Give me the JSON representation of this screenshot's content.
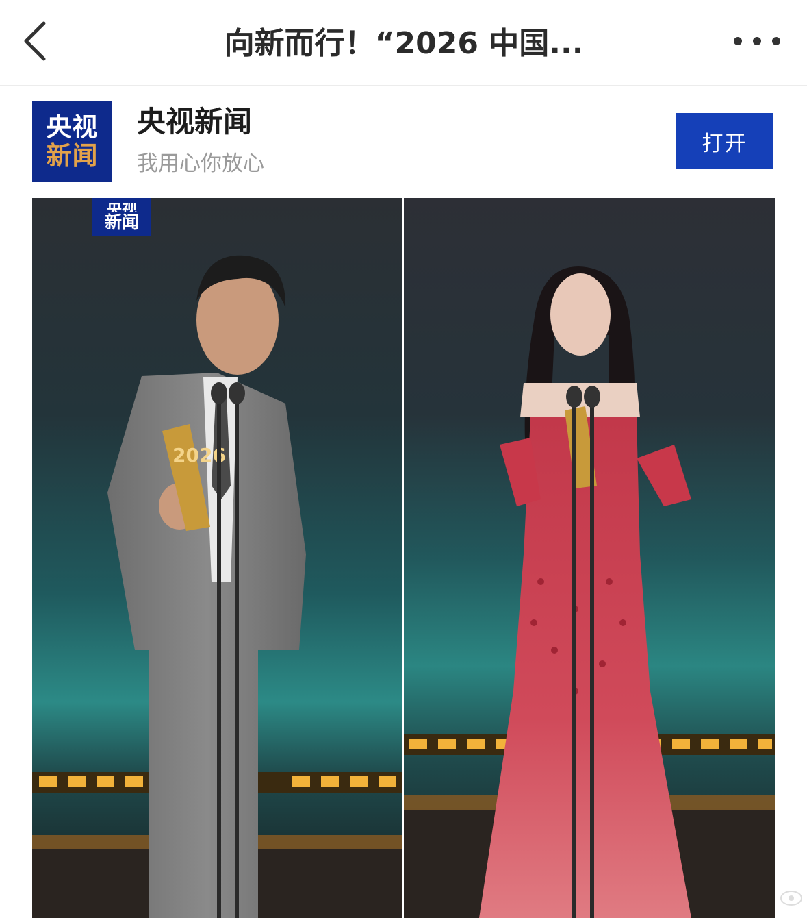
{
  "nav": {
    "title": "向新而行！“2026 中国...",
    "back_icon": "chevron-left-icon",
    "more_icon": "more-dots-icon"
  },
  "banner": {
    "logo_line1": "央视",
    "logo_line2": "新闻",
    "app_name": "央视新闻",
    "slogan": "我用心你放心",
    "open_label": "打开"
  },
  "photo": {
    "watermark_line1": "央视",
    "watermark_line2": "新闻",
    "trophy_text": "2026"
  },
  "colors": {
    "brand_blue": "#0e2a8c",
    "button_blue": "#1540b8",
    "logo_gold": "#e2a24a"
  }
}
